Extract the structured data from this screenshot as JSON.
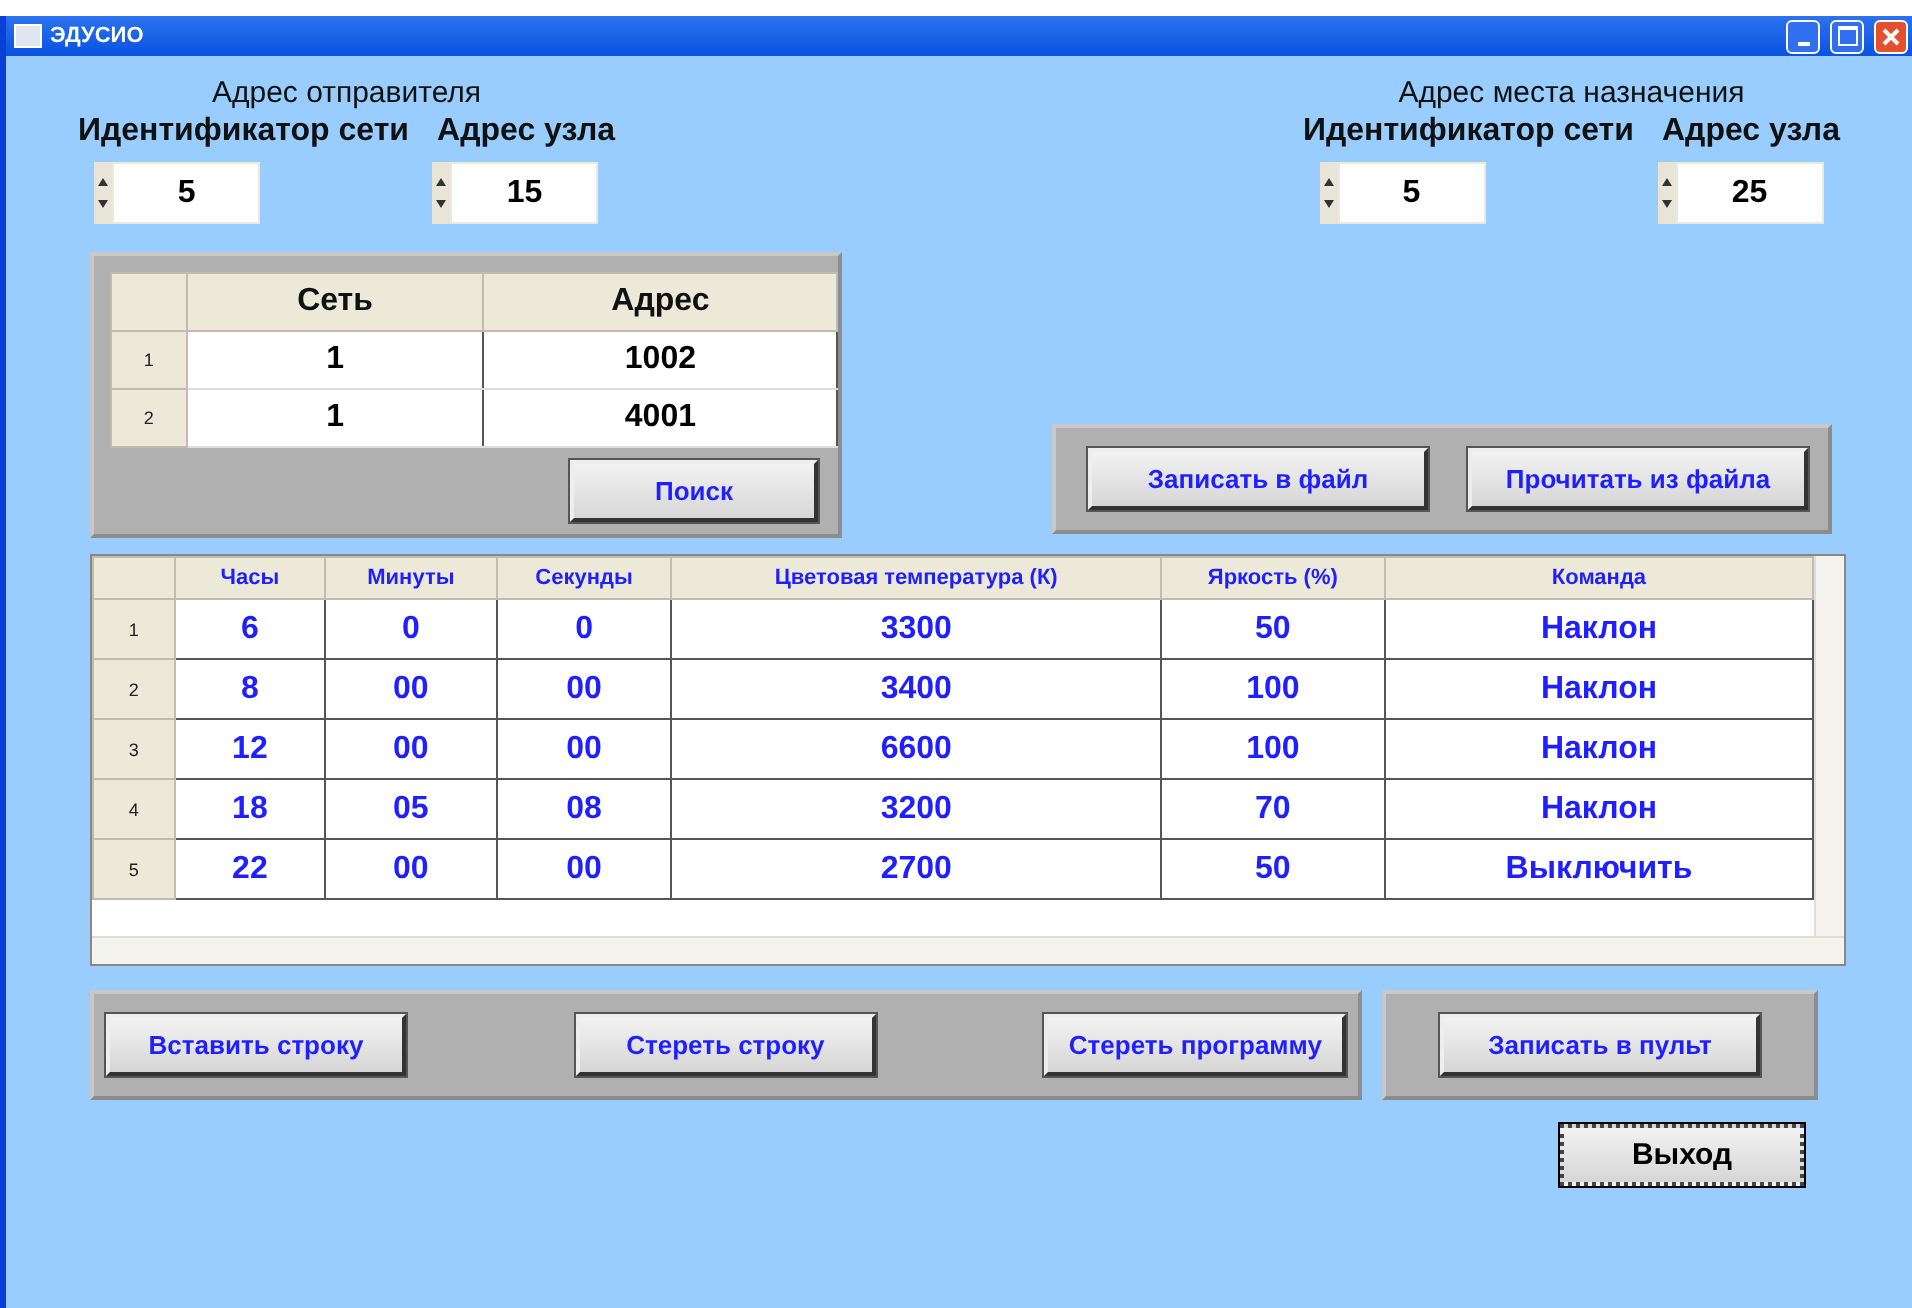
{
  "window": {
    "title": "ЭДУСИО"
  },
  "sender": {
    "title": "Адрес отправителя",
    "network_label": "Идентификатор сети",
    "node_label": "Адрес узла",
    "network_id": "5",
    "node_address": "15"
  },
  "destination": {
    "title": "Адрес места назначения",
    "network_label": "Идентификатор сети",
    "node_label": "Адрес узла",
    "network_id": "5",
    "node_address": "25"
  },
  "network_table": {
    "columns": [
      "Сеть",
      "Адрес"
    ],
    "rows": [
      {
        "number": "1",
        "cells": [
          "1",
          "1002"
        ]
      },
      {
        "number": "2",
        "cells": [
          "1",
          "4001"
        ]
      }
    ],
    "search_button": "Поиск"
  },
  "file_buttons": [
    "Записать в файл",
    "Прочитать из файла"
  ],
  "schedule": {
    "columns": [
      "Часы",
      "Минуты",
      "Секунды",
      "Цветовая температура (К)",
      "Яркость (%)",
      "Команда"
    ],
    "rows": [
      {
        "number": "1",
        "cells": [
          "6",
          "0",
          "0",
          "3300",
          "50",
          "Наклон"
        ]
      },
      {
        "number": "2",
        "cells": [
          "8",
          "00",
          "00",
          "3400",
          "100",
          "Наклон"
        ]
      },
      {
        "number": "3",
        "cells": [
          "12",
          "00",
          "00",
          "6600",
          "100",
          "Наклон"
        ]
      },
      {
        "number": "4",
        "cells": [
          "18",
          "05",
          "08",
          "3200",
          "70",
          "Наклон"
        ]
      },
      {
        "number": "5",
        "cells": [
          "22",
          "00",
          "00",
          "2700",
          "50",
          "Выключить"
        ]
      }
    ]
  },
  "row_buttons": [
    "Вставить строку",
    "Стереть строку",
    "Стереть программу"
  ],
  "upload_button": "Записать в пульт",
  "exit_button": "Выход"
}
